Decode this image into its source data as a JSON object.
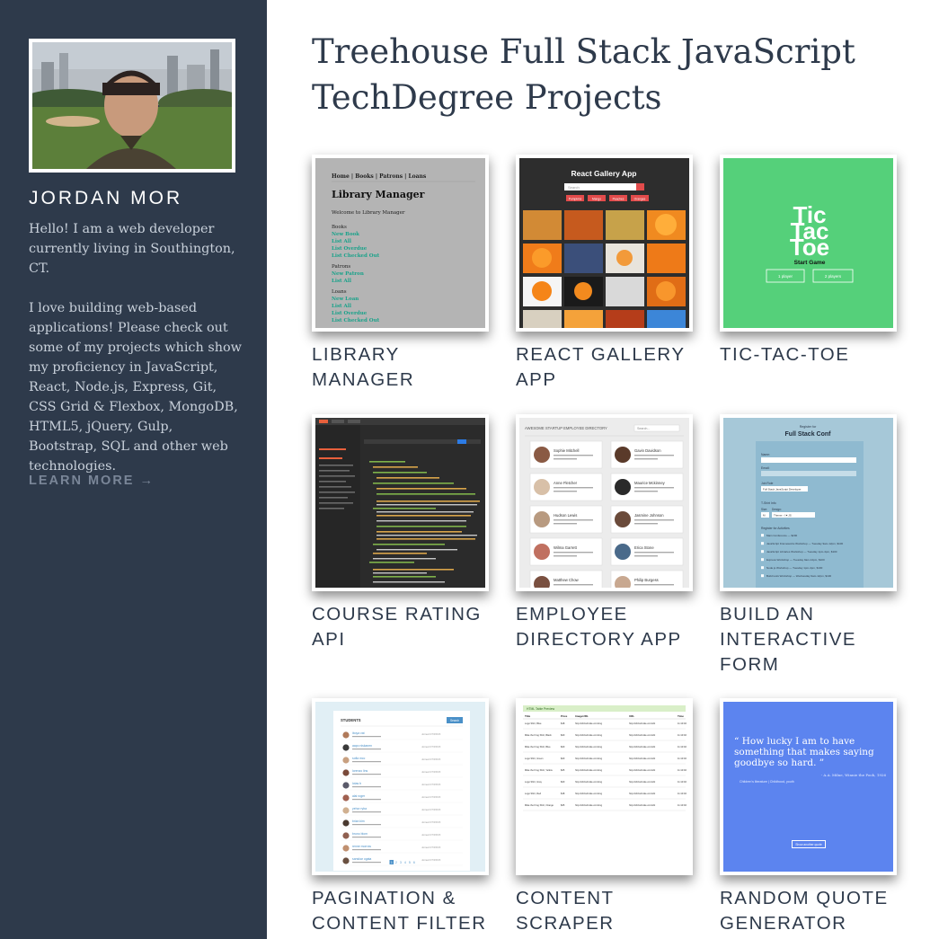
{
  "sidebar": {
    "author_name": "JORDAN MOR",
    "bio_intro": "Hello! I am a web developer currently living in Southington, CT.",
    "bio_skills": "I love building web-based applications! Please check out some of my projects which show my proficiency in JavaScript, React, Node.js, Express, Git, CSS Grid & Flexbox, MongoDB, HTML5, jQuery, Gulp, Bootstrap, SQL and other web technologies.",
    "learn_more": "LEARN MORE →"
  },
  "main": {
    "title": "Treehouse Full Stack JavaScript TechDegree Projects",
    "projects": [
      {
        "title": "LIBRARY MANAGER",
        "thumb": {
          "nav": "Home | Books | Patrons | Loans",
          "heading": "Library Manager",
          "welcome": "Welcome to Library Manager",
          "sections": [
            {
              "label": "Books",
              "links": [
                "New Book",
                "List All",
                "List Overdue",
                "List Checked Out"
              ]
            },
            {
              "label": "Patrons",
              "links": [
                "New Patron",
                "List All"
              ]
            },
            {
              "label": "Loans",
              "links": [
                "New Loan",
                "List All",
                "List Overdue",
                "List Checked Out"
              ]
            }
          ]
        }
      },
      {
        "title": "REACT GALLERY APP",
        "thumb": {
          "heading": "React Gallery App",
          "search_placeholder": "Search",
          "buttons": [
            "Pumpkins",
            "Mango",
            "Peaches",
            "Oranges"
          ]
        }
      },
      {
        "title": "TIC-TAC-TOE",
        "thumb": {
          "logo": [
            "Tic",
            "Tac",
            "Toe"
          ],
          "start": "Start Game",
          "options": [
            "1 player",
            "2 players"
          ]
        }
      },
      {
        "title": "COURSE RATING API"
      },
      {
        "title": "EMPLOYEE DIRECTORY APP",
        "thumb": {
          "heading": "AWESOME STARTUP EMPLOYEE DIRECTORY",
          "search_placeholder": "Search...",
          "employees": [
            "Sophie Mitchell",
            "Gavin Davidson",
            "Anne Fletcher",
            "Maurice Mckinney",
            "Hudson Lewis",
            "Jasmine Johnson",
            "Wilma Garrett",
            "Erica Stone",
            "Matthew Chow",
            "Philip Burgess"
          ]
        }
      },
      {
        "title": "BUILD AN INTERACTIVE FORM",
        "thumb": {
          "overline": "Register for",
          "heading": "Full Stack Conf",
          "fields": [
            "Name:",
            "Email:"
          ],
          "job_label": "Job Role",
          "job_value": "Full Stack JavaScript Developer",
          "tshirt_label": "T-Shirt Info",
          "size_label": "Size:",
          "size_value": "M",
          "design_label": "Design:",
          "design_value": "Theme - I ♥ JS",
          "activities_label": "Register for Activities",
          "activities": [
            "Main Conference — $200",
            "JavaScript Frameworks Workshop — Tuesday 9am-12pm, $100",
            "JavaScript Libraries Workshop — Tuesday 1pm-4pm, $100",
            "Express Workshop — Tuesday 9am-12pm, $100",
            "Node.js Workshop — Tuesday 1pm-4pm, $100",
            "Build tools Workshop — Wednesday 9am-12pm, $100"
          ]
        }
      },
      {
        "title": "PAGINATION & CONTENT FILTER",
        "thumb": {
          "heading": "STUDENTS",
          "search": "Search",
          "students": [
            "iboya vat",
            "aapo niskanen",
            "sofia mcc",
            "lorenzo lins",
            "lotas b",
            "alai roger",
            "yehor ryba",
            "brian kim",
            "bruno blom",
            "renne morrow",
            "sanskar ogata"
          ],
          "joined": "Joined 07/15/15",
          "pages": [
            "1",
            "2",
            "3",
            "4",
            "5",
            "6"
          ]
        }
      },
      {
        "title": "CONTENT SCRAPER",
        "thumb": {
          "heading": "HTML Table Preview",
          "columns": [
            "Title",
            "Price",
            "ImageURL",
            "URL",
            "Time"
          ],
          "rows": [
            [
              "Logo Shirt, Blue",
              "$18",
              "http://shirts4mike.com/img/shirts/shirt-101.jpg",
              "http://shirts4mike.com/shirt.php?id=101",
              "11:13:02"
            ],
            [
              "Mike the Frog Shirt, Black",
              "$20",
              "http://shirts4mike.com/img/shirts/shirt-102.jpg",
              "http://shirts4mike.com/shirt.php?id=102",
              "11:13:02"
            ],
            [
              "Mike the Frog Shirt, Blue",
              "$20",
              "http://shirts4mike.com/img/shirts/shirt-103.jpg",
              "http://shirts4mike.com/shirt.php?id=103",
              "11:13:02"
            ],
            [
              "Logo Shirt, Green",
              "$20",
              "http://shirts4mike.com/img/shirts/shirt-104.jpg",
              "http://shirts4mike.com/shirt.php?id=104",
              "11:13:02"
            ],
            [
              "Mike the Frog Shirt, Yellow",
              "$25",
              "http://shirts4mike.com/img/shirts/shirt-105.jpg",
              "http://shirts4mike.com/shirt.php?id=105",
              "11:13:02"
            ],
            [
              "Logo Shirt, Gray",
              "$20",
              "http://shirts4mike.com/img/shirts/shirt-106.jpg",
              "http://shirts4mike.com/shirt.php?id=106",
              "11:13:02"
            ],
            [
              "Logo Shirt, Red",
              "$18",
              "http://shirts4mike.com/img/shirts/shirt-107.jpg",
              "http://shirts4mike.com/shirt.php?id=107",
              "11:13:02"
            ],
            [
              "Mike the Frog Shirt, Orange",
              "$25",
              "http://shirts4mike.com/img/shirts/shirt-108.jpg",
              "http://shirts4mike.com/shirt.php?id=108",
              "11:13:02"
            ]
          ]
        }
      },
      {
        "title": "RANDOM QUOTE GENERATOR",
        "thumb": {
          "quote": "How lucky I am to have something that makes saying goodbye so hard.",
          "source": "- A.A. Milne, Winnie the Pooh, 1926",
          "tags": "Children's literature | Childhood, youth",
          "button": "Show another quote"
        }
      }
    ]
  },
  "colors": {
    "sidebar_bg": "#2e3a4b",
    "heading_text": "#2e3a4b",
    "tictactoe_bg": "#55d07a",
    "quote_bg": "#5c84ef",
    "form_bg": "#a6c8d8",
    "library_link": "#1aa28a"
  }
}
